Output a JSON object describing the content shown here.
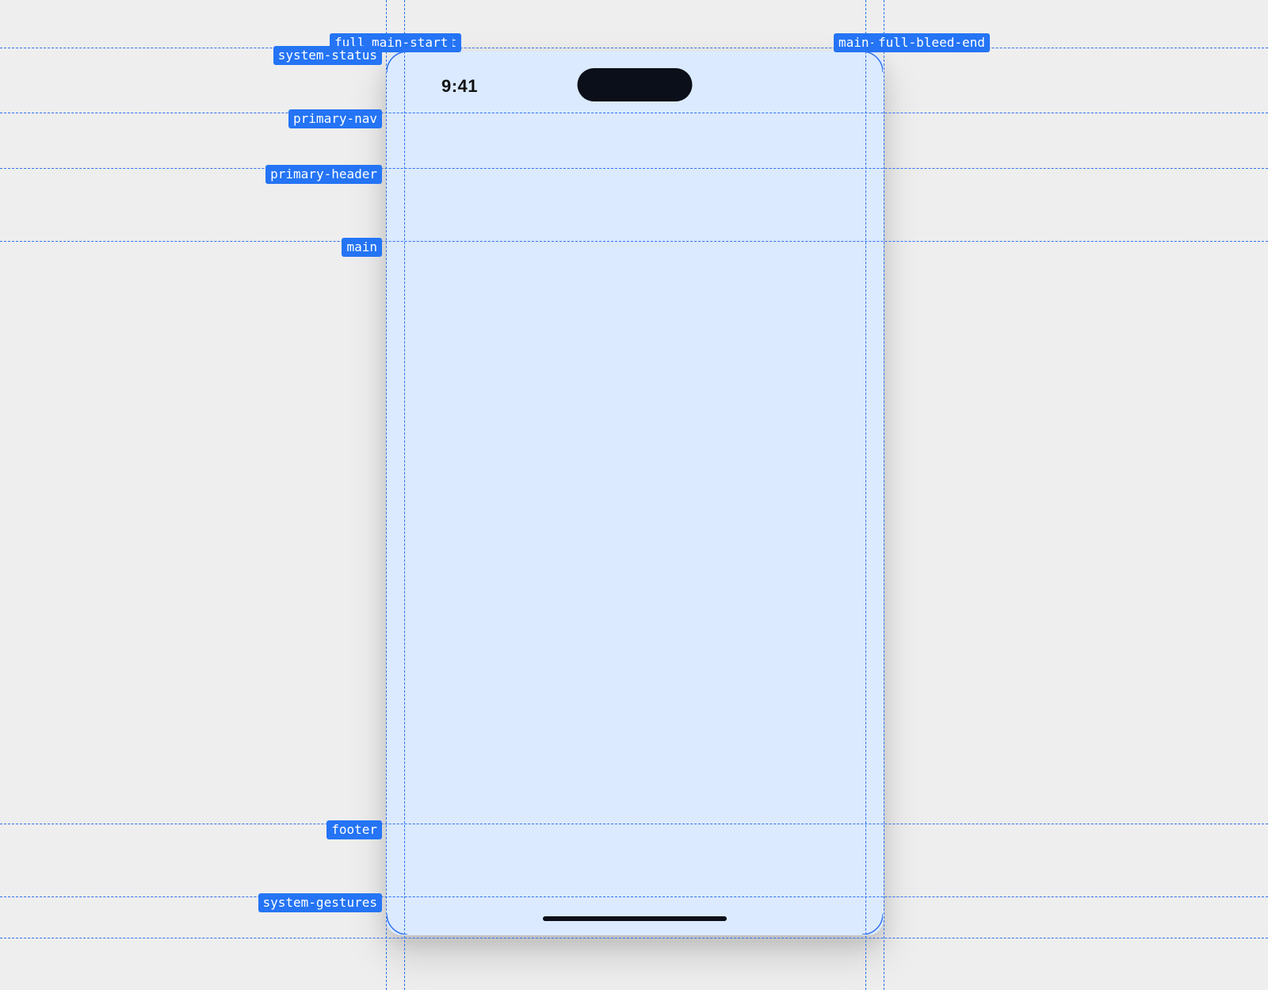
{
  "status": {
    "time": "9:41"
  },
  "guides": {
    "horizontal": {
      "system_status": 60,
      "top_labels_row": 44,
      "primary_nav": 142,
      "primary_header": 212,
      "main": 304,
      "footer": 1039,
      "system_gestures": 1131,
      "bottom_edge": 1183
    },
    "vertical": {
      "full_bleed_start": 487,
      "main_start": 510,
      "main_end": 1092,
      "full_bleed_end": 1115
    }
  },
  "labels": {
    "full_bleed_start": "full-bleed-start",
    "main_start": "main-start",
    "main_end": "main-end",
    "full_bleed_end": "full-bleed-end",
    "system_status": "system-status",
    "primary_nav": "primary-nav",
    "primary_header": "primary-header",
    "main": "main",
    "footer": "footer",
    "system_gestures": "system-gestures"
  }
}
